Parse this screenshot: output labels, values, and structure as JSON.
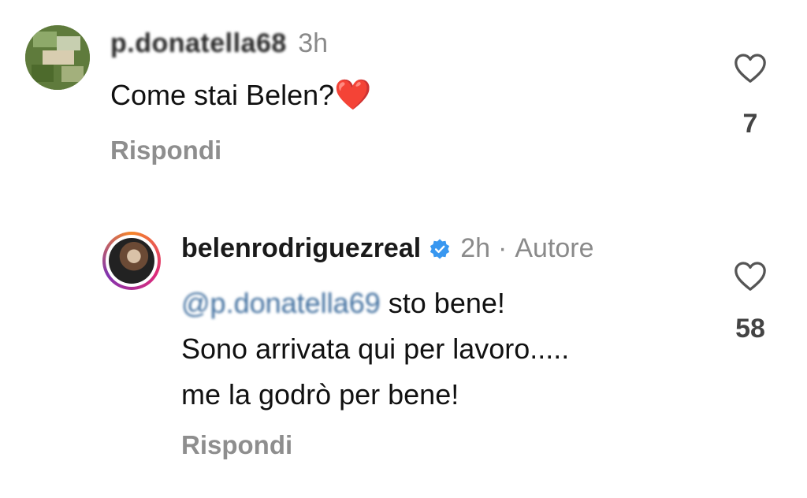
{
  "comments": [
    {
      "username": "p.donatella68",
      "time": "3h",
      "text": "Come stai Belen?",
      "emoji": "❤️",
      "reply_label": "Rispondi",
      "likes": "7"
    }
  ],
  "replies": [
    {
      "username": "belenrodriguezreal",
      "verified": true,
      "time": "2h",
      "separator": "·",
      "badge": "Autore",
      "mention": "@p.donatella69",
      "text_line1": "sto bene!",
      "text_line2": "Sono arrivata qui per lavoro.....",
      "text_line3": "me la godrò per bene!",
      "reply_label": "Rispondi",
      "likes": "58"
    }
  ],
  "colors": {
    "verified_badge": "#3897f0",
    "muted_text": "#8e8e8e",
    "story_ring": [
      "#f58529",
      "#dd2a7b",
      "#8134af"
    ]
  },
  "icons": {
    "like": "heart-outline-icon",
    "verified": "verified-check-icon"
  }
}
